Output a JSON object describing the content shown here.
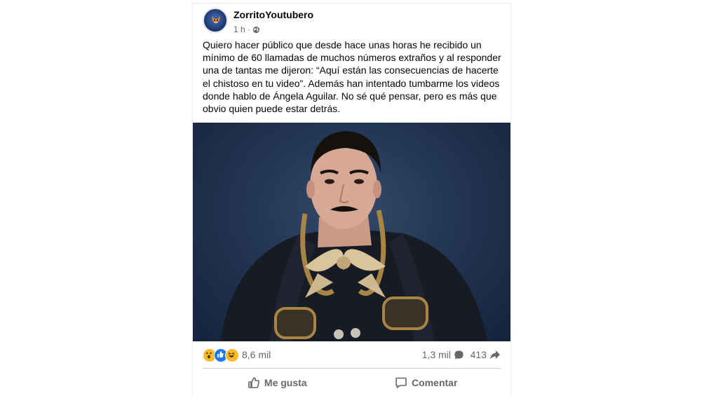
{
  "post": {
    "author": "ZorritoYoutubero",
    "time": "1 h",
    "separator": "·",
    "text_lines": [
      "Quiero hacer público que desde hace unas horas he recibido un",
      "mínimo de 60 llamadas de muchos números extraños y al responder",
      "una de tantas me dijeron: “Aquí están las consecuencias de hacerte",
      "el chistoso en tu video”. Además han intentado tumbarme los videos",
      "donde hablo de Ángela Aguilar. No sé qué pensar, pero es más que",
      "obvio quien puede estar detrás."
    ]
  },
  "stats": {
    "reaction_icons": [
      "wow-icon",
      "like-icon",
      "haha-icon"
    ],
    "reaction_count": "8,6 mil",
    "comment_count": "1,3 mil",
    "share_count": "413"
  },
  "actions": {
    "like_label": "Me gusta",
    "comment_label": "Comentar"
  },
  "colors": {
    "text": "#050505",
    "secondary_text": "#65676b",
    "divider": "#ced0d4",
    "like_blue": "#1877f2",
    "reaction_yellow": "#f7b928"
  }
}
